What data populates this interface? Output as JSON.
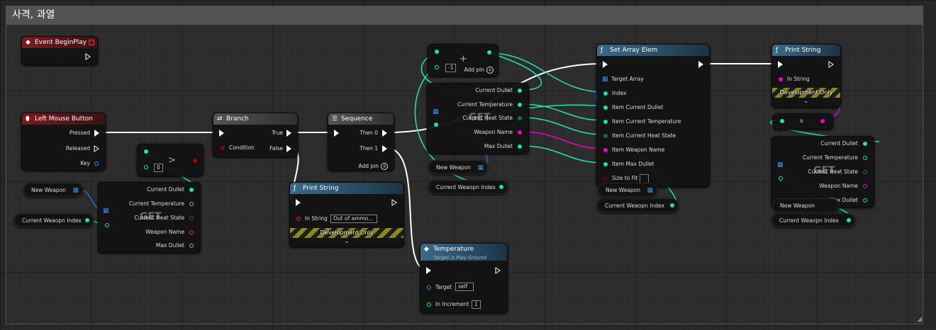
{
  "comment": {
    "title": "사격, 과열"
  },
  "colors": {
    "exec": "#ffffff",
    "int": "#1fe3af",
    "bool": "#8c0000",
    "string": "#f000c8",
    "struct": "#00a0ff",
    "array": "#3c8fe0",
    "event_header": "#7d1b1f",
    "function_header": "#3c6a88"
  },
  "nodes": {
    "begin_play": {
      "title": "Event BeginPlay"
    },
    "left_mouse": {
      "title": "Left Mouse Button",
      "pressed": "Pressed",
      "released": "Released",
      "key": "Key"
    },
    "greater": {
      "op": ">",
      "default_b": "0"
    },
    "branch": {
      "title": "Branch",
      "condition": "Condition",
      "true": "True",
      "false": "False"
    },
    "sequence": {
      "title": "Sequence",
      "then0": "Then 0",
      "then1": "Then 1",
      "add_pin": "Add pin"
    },
    "add_node": {
      "op": "+",
      "default_b": "-1",
      "add_pin": "Add pin"
    },
    "get_left": {
      "label": "GET",
      "pins": [
        "Current Dullet",
        "Current Temperature",
        "Current Heat State",
        "Weapon Name",
        "Max Dullet"
      ]
    },
    "get_mid": {
      "label": "GET",
      "pins": [
        "Current Dullet",
        "Current Temperature",
        "Current Heat State",
        "Weapon Name",
        "Max Dullet"
      ]
    },
    "get_right": {
      "label": "GET",
      "pins": [
        "Current Dullet",
        "Current Temperature",
        "Current Heat State",
        "Weapon Name",
        "Max Dullet"
      ]
    },
    "set_array_elem": {
      "title": "Set Array Elem",
      "pins": [
        "Target Array",
        "Index",
        "Item Current Dullet",
        "Item Current Temperature",
        "Item Current Heat State",
        "Item Weapon Name",
        "Item Max Dullet",
        "Size to Fit"
      ]
    },
    "print_string_1": {
      "title": "Print String",
      "in_string": "In String",
      "dev_only": "Development Only"
    },
    "print_string_2": {
      "title": "Print String",
      "in_string": "In String",
      "value": "Out of ammo...",
      "dev_only": "Development Only"
    },
    "temperature": {
      "title": "Temperature",
      "subtitle": "Target is Play Ground",
      "target": "Target",
      "target_value": "self",
      "in_increment": "In Increment",
      "increment_value": "1"
    },
    "make_struct": {
      "label": "o"
    }
  },
  "variables": {
    "new_weapon": "New Weapon",
    "current_weapon_index": "Current Weaopn Index"
  }
}
